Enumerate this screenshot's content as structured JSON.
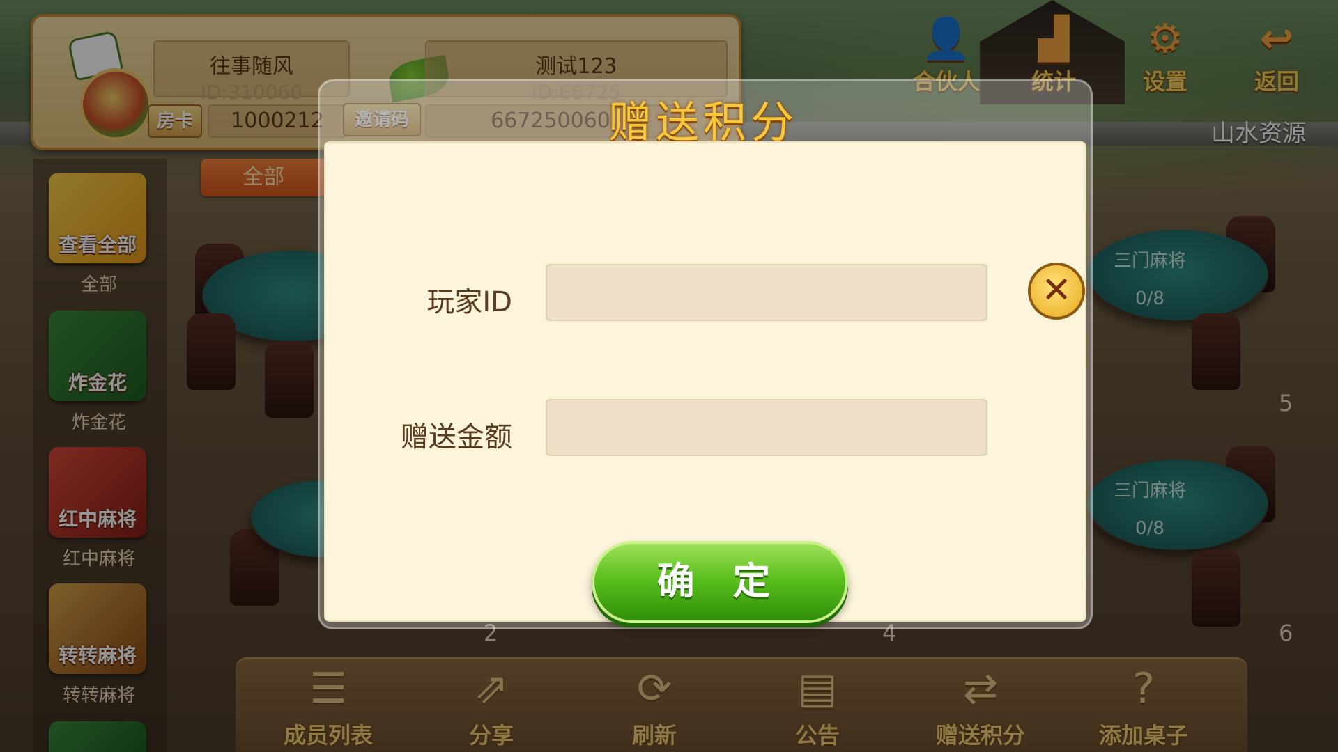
{
  "player": {
    "name": "往事随风",
    "id_text": "ID:310060",
    "room_card_label": "房卡",
    "room_card_value": "1000212"
  },
  "club": {
    "name": "测试123",
    "id_text": "ID:66725",
    "invite_label": "邀请码",
    "invite_value": "667250060"
  },
  "nav": {
    "partner": "合伙人",
    "stats": "统计",
    "settings": "设置",
    "back": "返回"
  },
  "brand": "山水资源",
  "filter_tab": "全部",
  "games": [
    {
      "tile": "查看全部",
      "label": "全部"
    },
    {
      "tile": "炸金花",
      "label": "炸金花"
    },
    {
      "tile": "红中麻将",
      "label": "红中麻将"
    },
    {
      "tile": "转转麻将",
      "label": "转转麻将"
    }
  ],
  "tables": [
    {
      "name": "三门麻将",
      "seats": "0/8",
      "number": "5"
    },
    {
      "name": "三门麻将",
      "seats": "0/8",
      "number": "6"
    },
    {
      "number": "2"
    },
    {
      "number": "4"
    }
  ],
  "bottom_bar": [
    {
      "label": "成员列表",
      "icon": "member-list-icon"
    },
    {
      "label": "分享",
      "icon": "share-icon"
    },
    {
      "label": "刷新",
      "icon": "refresh-icon"
    },
    {
      "label": "公告",
      "icon": "announcement-icon"
    },
    {
      "label": "赠送积分",
      "icon": "gift-points-icon"
    },
    {
      "label": "添加桌子",
      "icon": "add-table-icon"
    }
  ],
  "dialog": {
    "title": "赠送积分",
    "player_id_label": "玩家ID",
    "player_id_value": "",
    "amount_label": "赠送金额",
    "amount_value": "",
    "confirm": "确 定"
  },
  "colors": {
    "accent_gold": "#f7c73c",
    "confirm_green": "#5bbf1e",
    "dialog_bg": "#fdf4dc"
  }
}
